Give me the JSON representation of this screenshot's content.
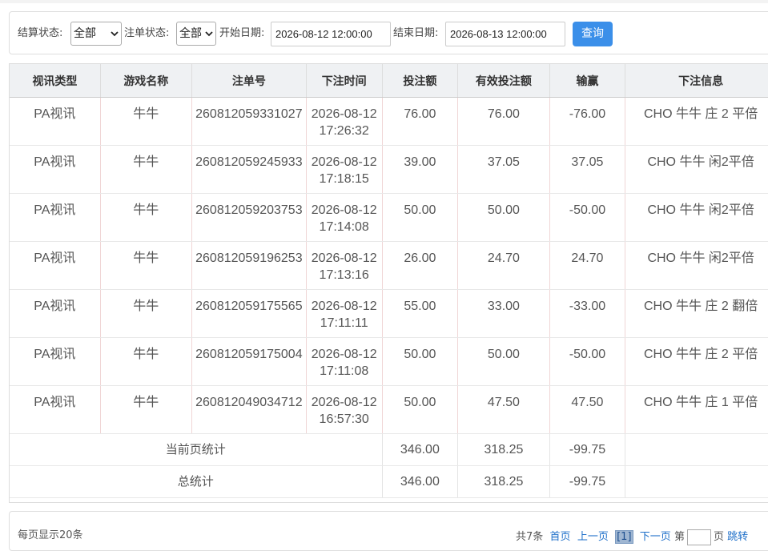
{
  "filters": {
    "settle_status_label": "结算状态:",
    "settle_status_value": "全部",
    "bet_status_label": "注单状态:",
    "bet_status_value": "全部",
    "start_date_label": "开始日期:",
    "start_date_value": "2026-08-12 12:00:00",
    "end_date_label": "结束日期:",
    "end_date_value": "2026-08-13 12:00:00",
    "query_label": "查询"
  },
  "table": {
    "headers": [
      "视讯类型",
      "游戏名称",
      "注单号",
      "下注时间",
      "投注额",
      "有效投注额",
      "输赢",
      "下注信息"
    ],
    "rows": [
      {
        "type": "PA视讯",
        "game": "牛牛",
        "order": "260812059331027",
        "date": "2026-08-12",
        "time": "17:26:32",
        "bet": "76.00",
        "valid": "76.00",
        "winloss": "-76.00",
        "info": "CHO 牛牛 庄 2 平倍"
      },
      {
        "type": "PA视讯",
        "game": "牛牛",
        "order": "260812059245933",
        "date": "2026-08-12",
        "time": "17:18:15",
        "bet": "39.00",
        "valid": "37.05",
        "winloss": "37.05",
        "info": "CHO 牛牛 闲2平倍"
      },
      {
        "type": "PA视讯",
        "game": "牛牛",
        "order": "260812059203753",
        "date": "2026-08-12",
        "time": "17:14:08",
        "bet": "50.00",
        "valid": "50.00",
        "winloss": "-50.00",
        "info": "CHO 牛牛 闲2平倍"
      },
      {
        "type": "PA视讯",
        "game": "牛牛",
        "order": "260812059196253",
        "date": "2026-08-12",
        "time": "17:13:16",
        "bet": "26.00",
        "valid": "24.70",
        "winloss": "24.70",
        "info": "CHO 牛牛 闲2平倍"
      },
      {
        "type": "PA视讯",
        "game": "牛牛",
        "order": "260812059175565",
        "date": "2026-08-12",
        "time": "17:11:11",
        "bet": "55.00",
        "valid": "33.00",
        "winloss": "-33.00",
        "info": "CHO 牛牛 庄 2 翻倍"
      },
      {
        "type": "PA视讯",
        "game": "牛牛",
        "order": "260812059175004",
        "date": "2026-08-12",
        "time": "17:11:08",
        "bet": "50.00",
        "valid": "50.00",
        "winloss": "-50.00",
        "info": "CHO 牛牛 庄 2 平倍"
      },
      {
        "type": "PA视讯",
        "game": "牛牛",
        "order": "260812049034712",
        "date": "2026-08-12",
        "time": "16:57:30",
        "bet": "50.00",
        "valid": "47.50",
        "winloss": "47.50",
        "info": "CHO 牛牛 庄 1 平倍"
      }
    ],
    "page_summary": {
      "label": "当前页统计",
      "bet": "346.00",
      "valid": "318.25",
      "winloss": "-99.75"
    },
    "total_summary": {
      "label": "总统计",
      "bet": "346.00",
      "valid": "318.25",
      "winloss": "-99.75"
    }
  },
  "pager": {
    "per_page": "每页显示20条",
    "total": "共7条",
    "first": "首页",
    "prev": "上一页",
    "current": "[1]",
    "next": "下一页",
    "page_prefix": "第",
    "page_suffix": "页",
    "jump": "跳转"
  },
  "colors": {
    "query_button": "#3b8fe9",
    "header_bg": "#eff1f3",
    "link": "#1e6fc9"
  },
  "icons": {
    "select_arrow": "chevron-down-icon"
  }
}
